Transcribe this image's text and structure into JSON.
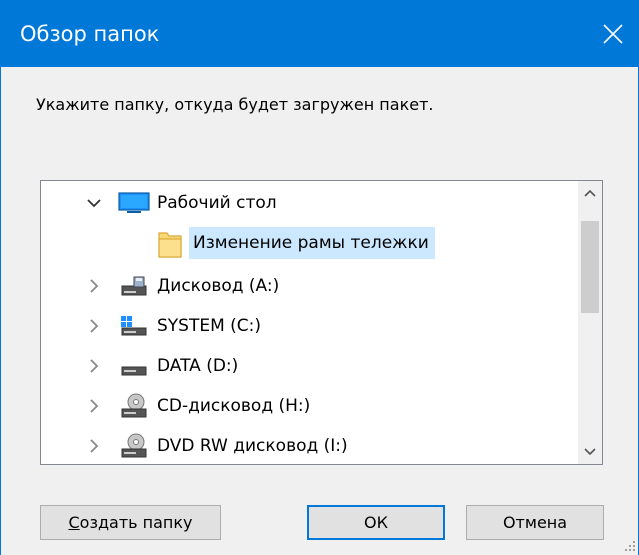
{
  "window": {
    "title": "Обзор папок"
  },
  "prompt": "Укажите папку, откуда будет загружен пакет.",
  "tree": {
    "items": [
      {
        "label": "Рабочий стол",
        "icon": "desktop-icon",
        "expanded": true
      },
      {
        "label": "Изменение рамы тележки",
        "icon": "folder-icon",
        "selected": true
      },
      {
        "label": "Дисковод (A:)",
        "icon": "floppy-drive-icon"
      },
      {
        "label": "SYSTEM (C:)",
        "icon": "windows-drive-icon"
      },
      {
        "label": "DATA (D:)",
        "icon": "hard-drive-icon"
      },
      {
        "label": "CD-дисковод (H:)",
        "icon": "cd-drive-icon"
      },
      {
        "label": "DVD RW дисковод (I:)",
        "icon": "dvd-drive-icon"
      }
    ]
  },
  "buttons": {
    "new_folder": "Создать папку",
    "ok": "ОК",
    "cancel": "Отмена"
  },
  "colors": {
    "accent": "#0078d7",
    "selection": "#cce8ff"
  }
}
